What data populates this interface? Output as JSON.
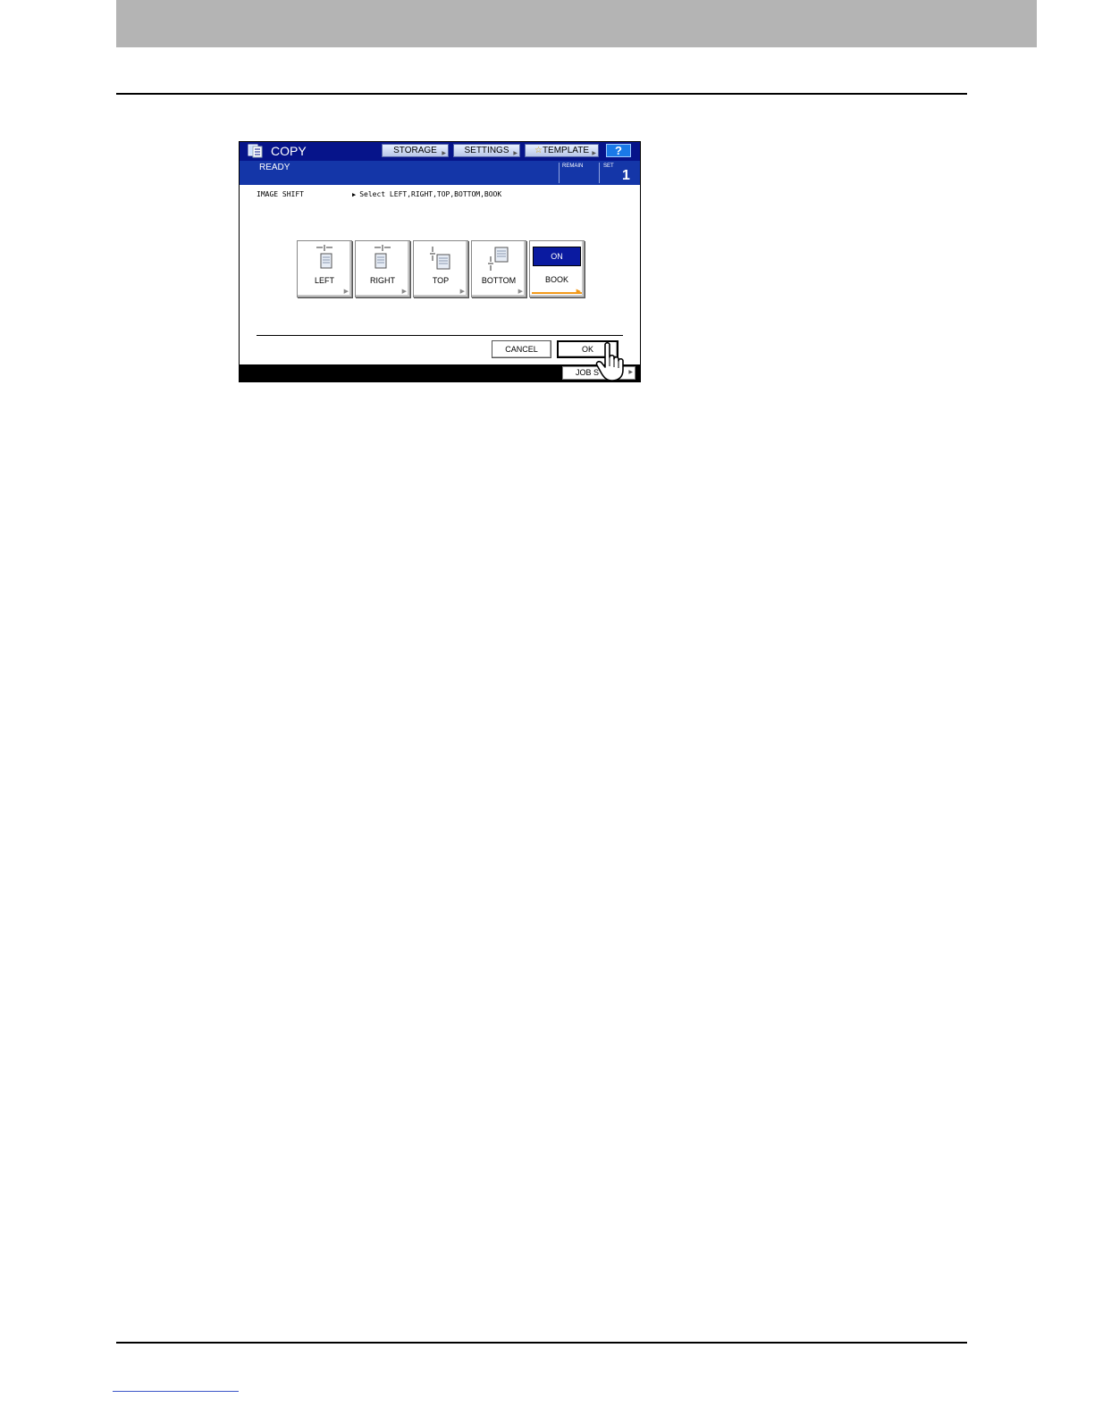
{
  "panel": {
    "app_title": "COPY",
    "toolbar": {
      "storage_label": "STORAGE",
      "settings_label": "SETTINGS",
      "template_label": "TEMPLATE",
      "help_label": "?"
    },
    "status": {
      "text": "READY",
      "remain_label": "REMAIN",
      "set_label": "SET",
      "set_value": "1"
    },
    "section_label": "IMAGE SHIFT",
    "instruction": "Select LEFT,RIGHT,TOP,BOTTOM,BOOK",
    "options": {
      "left": "LEFT",
      "right": "RIGHT",
      "top": "TOP",
      "bottom": "BOTTOM",
      "book": "BOOK",
      "book_state": "ON"
    },
    "actions": {
      "cancel": "CANCEL",
      "ok": "OK"
    },
    "job_status_label": "JOB S"
  },
  "colors": {
    "titlebar": "#06148a",
    "statusbar": "#1436a8",
    "on_badge": "#0a1aa0",
    "selected_underline": "#f29a1a",
    "header_band": "#b4b4b4"
  },
  "icons": [
    "copy-app-icon",
    "star-icon",
    "help-icon",
    "page-left-icon",
    "page-right-icon",
    "page-top-icon",
    "page-bottom-icon",
    "hand-pointer-icon"
  ]
}
